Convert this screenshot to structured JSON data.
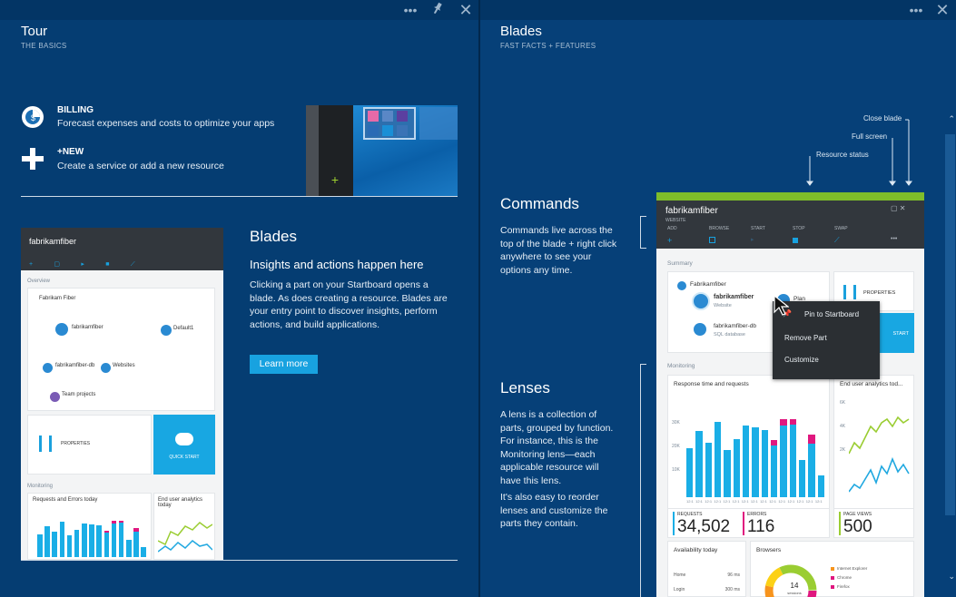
{
  "left_blade": {
    "title": "Tour",
    "subtitle": "THE BASICS",
    "features": [
      {
        "icon": "billing-icon",
        "title": "BILLING",
        "text": "Forecast expenses and costs to optimize your apps"
      },
      {
        "icon": "plus-icon",
        "title": "+NEW",
        "text": "Create a service or add a new resource"
      }
    ],
    "blades_section": {
      "heading": "Blades",
      "subheading": "Insights and actions happen here",
      "body": "Clicking a part on your Startboard opens a blade. As does creating a resource. Blades are your entry point to discover insights, perform actions, and build applications.",
      "button": "Learn more"
    },
    "mini_blade": {
      "name": "fabrikamfiber",
      "overview": "Overview",
      "items": [
        "Fabrikam Fiber",
        "fabrikamfiber",
        "Default1",
        "fabrikamfiber-db",
        "Websites",
        "Team projects"
      ],
      "properties": "PROPERTIES",
      "quick_start": "QUICK START",
      "monitoring": "Monitoring",
      "tile1": "Requests and Errors today",
      "tile2": "End user analytics today"
    }
  },
  "right_blade": {
    "title": "Blades",
    "subtitle": "FAST FACTS + FEATURES",
    "commands_heading": "Commands",
    "commands_text": "Commands live across the top of the blade + right click anywhere to see your options any time.",
    "lenses_heading": "Lenses",
    "lenses_text1": "A lens is a collection of parts, grouped by function. For instance, this is the Monitoring lens—each applicable resource will have this lens.",
    "lenses_text2": "It's also easy to reorder lenses and customize the parts they contain.",
    "callouts": {
      "close": "Close blade",
      "full": "Full screen",
      "status": "Resource status"
    },
    "sample_blade": {
      "name": "fabrikamfiber",
      "type": "WEBSITE",
      "commands": [
        "ADD",
        "BROWSE",
        "START",
        "STOP",
        "SWAP"
      ],
      "summary": "Summary",
      "resources": [
        {
          "name": "Fabrikamfiber",
          "sub": ""
        },
        {
          "name": "fabrikamfiber",
          "sub": "Website"
        },
        {
          "name": "fabrikamfiber-db",
          "sub": "SQL database"
        },
        {
          "name": "Plan",
          "sub": ""
        }
      ],
      "properties": "PROPERTIES",
      "start": "START",
      "monitoring": "Monitoring",
      "chart_title": "Response time and requests",
      "analytics_title": "End user analytics tod...",
      "y_ticks": [
        "30K",
        "20K",
        "10K"
      ],
      "x_ticks": [
        "12:1",
        "12:1",
        "12:1",
        "12:1",
        "12:1",
        "12:1",
        "12:1",
        "12:1",
        "12:1",
        "12:1",
        "12:1",
        "12:1",
        "12:1",
        "12:1",
        "12:1"
      ],
      "an_ticks": [
        "6K",
        "4K",
        "2K"
      ],
      "requests_label": "REQUESTS",
      "requests_value": "34,502",
      "errors_label": "ERRORS",
      "errors_value": "116",
      "pageviews_label": "PAGE VIEWS",
      "pageviews_value": "500",
      "availability_title": "Availability today",
      "availability_rows": [
        {
          "name": "Home",
          "value": "96 ms"
        },
        {
          "name": "Login",
          "value": "300 ms"
        }
      ],
      "browsers_title": "Browsers",
      "browsers_center": "14",
      "browsers_center_label": "sessions",
      "browsers_legend": [
        "Internet Explorer",
        "Chrome",
        "Firefox"
      ],
      "bars": [
        0.55,
        0.74,
        0.61,
        0.85,
        0.53,
        0.65,
        0.81,
        0.79,
        0.76,
        0.64,
        0.88,
        0.88,
        0.42,
        0.7,
        0.25
      ],
      "error_bars": [
        0,
        0,
        0,
        0,
        0,
        0,
        0,
        0,
        0,
        0.06,
        0.07,
        0.06,
        0,
        0.1,
        0
      ]
    },
    "context_menu": [
      "Pin to Startboard",
      "Remove Part",
      "Customize"
    ]
  }
}
